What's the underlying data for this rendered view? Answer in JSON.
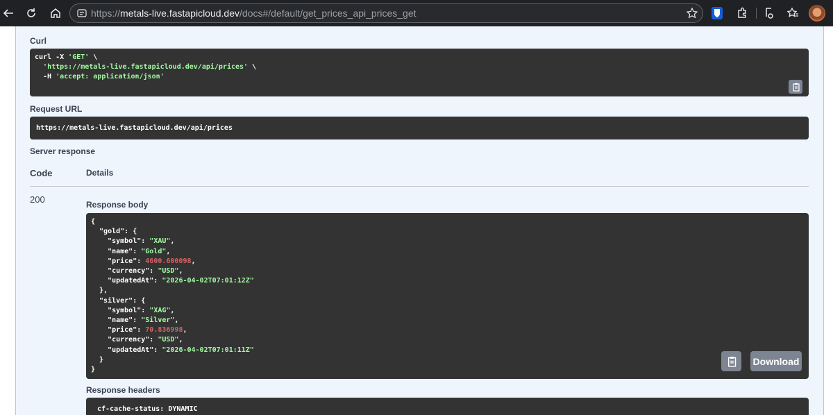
{
  "browser": {
    "url_scheme": "https://",
    "url_host": "metals-live.fastapicloud.dev",
    "url_path": "/docs#/default/get_prices_api_prices_get"
  },
  "curl": {
    "label": "Curl",
    "line1_a": "curl -X ",
    "line1_b": "'GET'",
    "line1_c": " \\",
    "line2_a": "  ",
    "line2_b": "'https://metals-live.fastapicloud.dev/api/prices'",
    "line2_c": " \\",
    "line3_a": "  -H ",
    "line3_b": "'accept: application/json'"
  },
  "request_url": {
    "label": "Request URL",
    "value": "https://metals-live.fastapicloud.dev/api/prices"
  },
  "server_response": {
    "label": "Server response",
    "col_code": "Code",
    "col_details": "Details",
    "status_code": "200",
    "body_label": "Response body",
    "headers_label": "Response headers",
    "download_label": "Download",
    "header_line": "cf-cache-status: DYNAMIC"
  },
  "response_body": {
    "gold": {
      "symbol": "\"XAU\"",
      "name": "\"Gold\"",
      "price": "4600.600098",
      "currency": "\"USD\"",
      "updatedAt": "\"2026-04-02T07:01:12Z\""
    },
    "silver": {
      "symbol": "\"XAG\"",
      "name": "\"Silver\"",
      "price": "70.836998",
      "currency": "\"USD\"",
      "updatedAt": "\"2026-04-02T07:01:11Z\""
    }
  },
  "colors": {
    "code_bg": "#333333",
    "string": "#a2fca2",
    "number": "#d36363",
    "panel": "#eef5fd",
    "button": "#7d8492"
  },
  "icons": [
    "back-arrow-icon",
    "reload-icon",
    "home-icon",
    "site-info-icon",
    "bookmark-star-icon",
    "bitwarden-icon",
    "extensions-icon",
    "reading-list-icon",
    "favorites-icon",
    "profile-avatar",
    "copy-icon"
  ]
}
